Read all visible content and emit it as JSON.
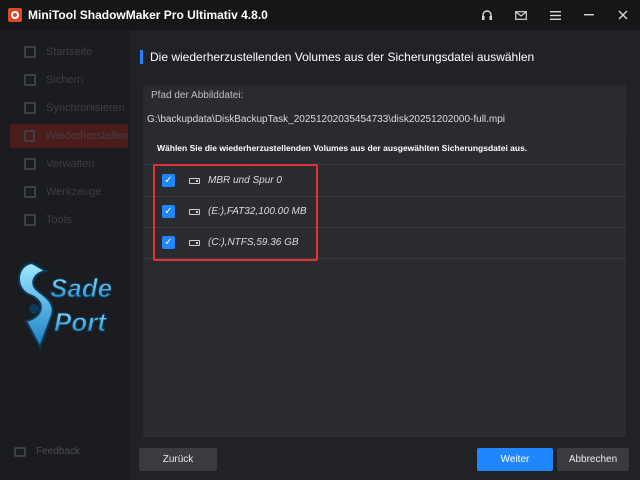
{
  "app": {
    "title": "MiniTool ShadowMaker Pro Ultimativ 4.8.0"
  },
  "window_controls": [
    {
      "name": "headset-icon",
      "glyph": "🎧"
    },
    {
      "name": "mail-icon",
      "glyph": "✉"
    },
    {
      "name": "menu-icon",
      "glyph": "≡"
    },
    {
      "name": "minimize-icon",
      "glyph": "—"
    },
    {
      "name": "close-icon",
      "glyph": "✕"
    }
  ],
  "sidebar": {
    "items": [
      {
        "label": "Startseite",
        "icon": "home-icon"
      },
      {
        "label": "Sichern",
        "icon": "backup-icon"
      },
      {
        "label": "Synchronisieren",
        "icon": "sync-icon"
      },
      {
        "label": "Wiederherstellen",
        "icon": "restore-icon",
        "active": true
      },
      {
        "label": "Verwalten",
        "icon": "manage-icon"
      },
      {
        "label": "Werkzeuge",
        "icon": "tools-icon"
      },
      {
        "label": "Tools",
        "icon": "tools-grid-icon"
      }
    ],
    "feedback": "Feedback"
  },
  "watermark": {
    "line1": "Sade",
    "line2": "Port"
  },
  "main": {
    "title": "Die wiederherzustellenden Volumes aus der Sicherungsdatei auswählen",
    "path_label": "Pfad der Abbilddatei:",
    "path_value": "G:\\backupdata\\DiskBackupTask_20251202035454733\\disk20251202000-full.mpi",
    "instruction": "Wählen Sie die wiederherzustellenden Volumes aus der ausgewählten Sicherungsdatei aus.",
    "volumes": [
      {
        "label": "MBR und Spur 0",
        "checked": true
      },
      {
        "label": "(E:),FAT32,100.00 MB",
        "checked": true
      },
      {
        "label": "(C:),NTFS,59.36 GB",
        "checked": true
      }
    ]
  },
  "footer": {
    "back": "Zurück",
    "next": "Weiter",
    "cancel": "Abbrechen"
  },
  "colors": {
    "accent": "#1f86ff",
    "highlight": "#e33232",
    "active_nav": "#4a1c1c"
  }
}
